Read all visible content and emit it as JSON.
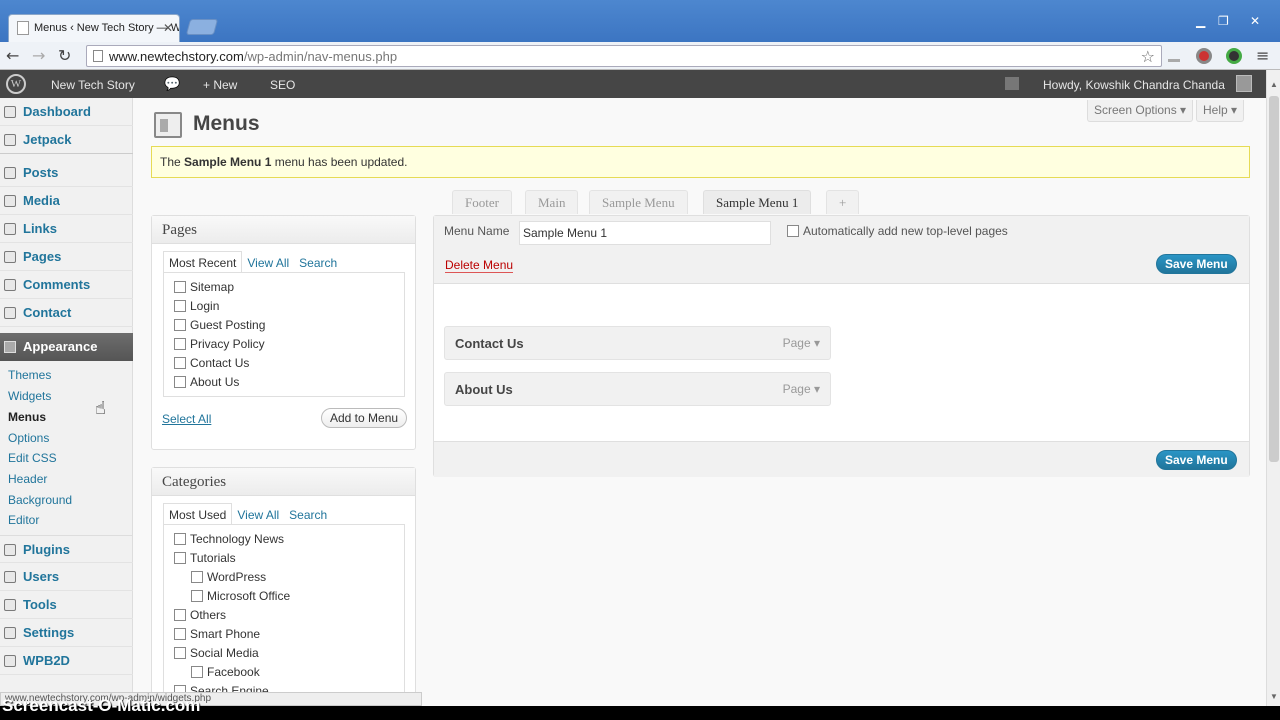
{
  "browser": {
    "tab_title": "Menus ‹ New Tech Story — W",
    "url_host": "www.newtechstory.com",
    "url_path": "/wp-admin/nav-menus.php"
  },
  "adminbar": {
    "site_name": "New Tech Story",
    "new_label": "+ New",
    "seo_label": "SEO",
    "howdy": "Howdy, Kowshik Chandra Chanda"
  },
  "sidebar": {
    "top": [
      "Dashboard",
      "Jetpack"
    ],
    "main": [
      "Posts",
      "Media",
      "Links",
      "Pages",
      "Comments",
      "Contact"
    ],
    "appearance": "Appearance",
    "appearance_sub": [
      "Themes",
      "Widgets",
      "Menus",
      "Options",
      "Edit CSS",
      "Header",
      "Background",
      "Editor"
    ],
    "bottom": [
      "Plugins",
      "Users",
      "Tools",
      "Settings",
      "WPB2D"
    ]
  },
  "screen": {
    "options": "Screen Options ▾",
    "help": "Help ▾"
  },
  "page_title": "Menus",
  "notice": {
    "pre": "The ",
    "name": "Sample Menu 1",
    "post": " menu has been updated."
  },
  "pages_box": {
    "title": "Pages",
    "tabs": [
      "Most Recent",
      "View All",
      "Search"
    ],
    "items": [
      "Sitemap",
      "Login",
      "Guest Posting",
      "Privacy Policy",
      "Contact Us",
      "About Us"
    ],
    "select_all": "Select All",
    "add": "Add to Menu"
  },
  "categories_box": {
    "title": "Categories",
    "tabs": [
      "Most Used",
      "View All",
      "Search"
    ],
    "items": [
      "Technology News",
      "Tutorials",
      "WordPress",
      "Microsoft Office",
      "Others",
      "Smart Phone",
      "Social Media",
      "Facebook",
      "Search Engine"
    ]
  },
  "menu_tabs": [
    "Footer",
    "Main",
    "Sample Menu",
    "Sample Menu 1",
    "+"
  ],
  "editor": {
    "name_label": "Menu Name",
    "name_value": "Sample Menu 1",
    "auto_add": "Automatically add new top-level pages",
    "delete": "Delete Menu",
    "save": "Save Menu",
    "items": [
      {
        "title": "Contact Us",
        "type": "Page"
      },
      {
        "title": "About Us",
        "type": "Page"
      }
    ]
  },
  "status_bar": "www.newtechstory.com/wp-admin/widgets.php",
  "watermark": "Screencast-O-Matic.com"
}
